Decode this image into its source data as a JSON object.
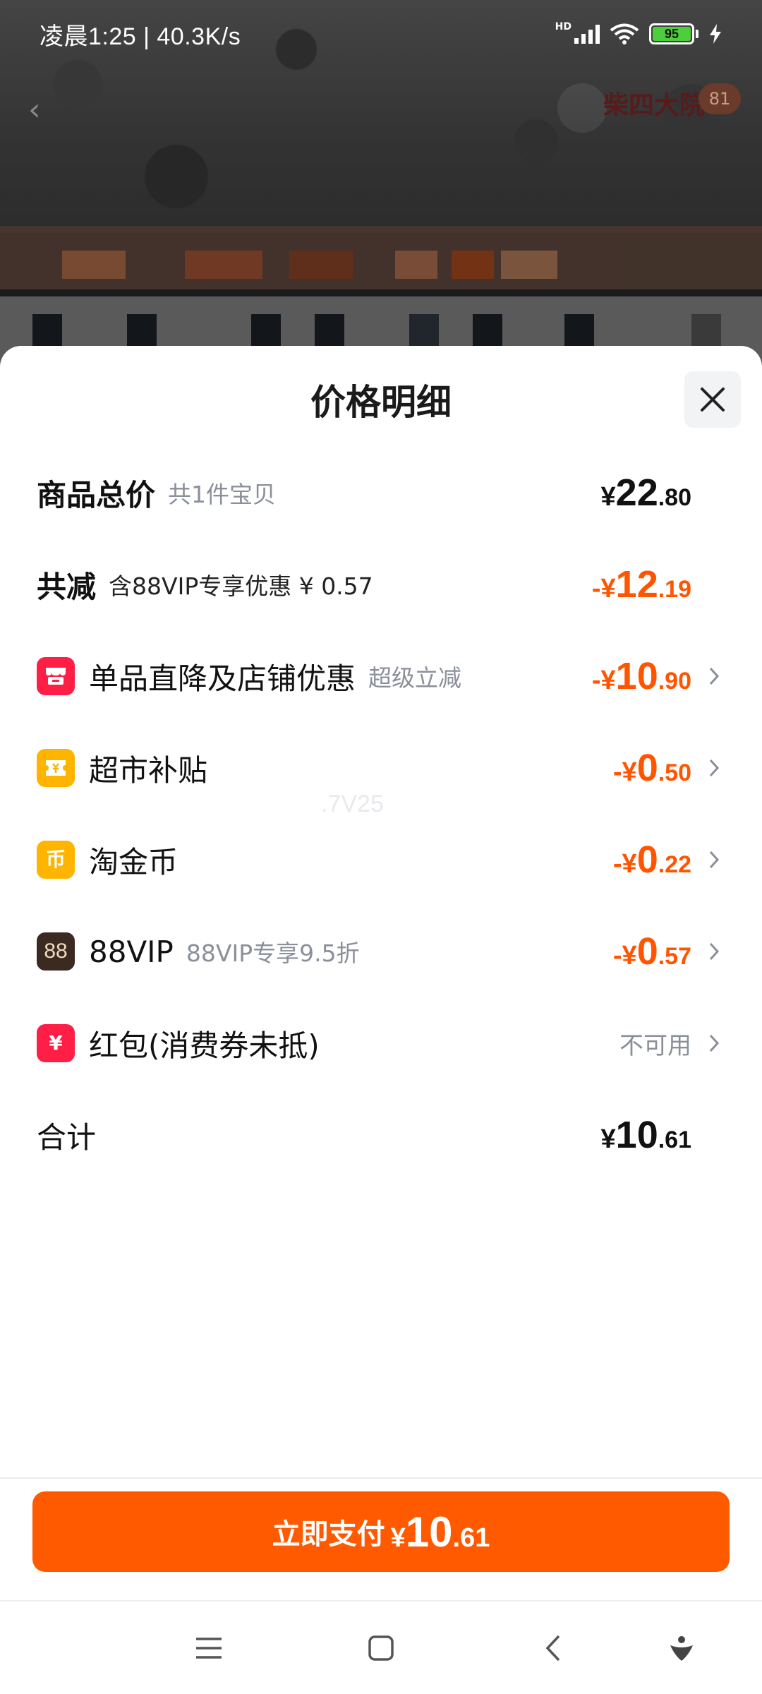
{
  "status_bar": {
    "time": "凌晨1:25 | 40.3K/s",
    "network_label": "HD",
    "battery": "95"
  },
  "background": {
    "badge_count": "81",
    "store_logo": "柴四大院"
  },
  "sheet": {
    "title": "价格明细",
    "close_icon": "close-icon",
    "watermark": ".7V25",
    "rows": [
      {
        "label": "商品总价",
        "sub": "共1件宝贝",
        "currency": "¥",
        "int": "22",
        "dec": ".80"
      },
      {
        "label": "共减",
        "sub": "含88VIP专享优惠 ¥ 0.57",
        "currency": "-¥",
        "int": "12",
        "dec": ".19"
      },
      {
        "label": "单品直降及店铺优惠",
        "sub": "超级立减",
        "icon": "store-icon",
        "currency": "-¥",
        "int": "10",
        "dec": ".90"
      },
      {
        "label": "超市补贴",
        "icon": "coupon-icon",
        "currency": "-¥",
        "int": "0",
        "dec": ".50"
      },
      {
        "label": "淘金币",
        "icon": "coin-icon",
        "icon_text": "币",
        "currency": "-¥",
        "int": "0",
        "dec": ".22"
      },
      {
        "label": "88VIP",
        "sub": "88VIP专享9.5折",
        "icon": "vip-icon",
        "icon_text": "88",
        "currency": "-¥",
        "int": "0",
        "dec": ".57"
      },
      {
        "label": "红包(消费券未抵)",
        "icon": "red-packet-icon",
        "icon_text": "¥",
        "status": "不可用"
      },
      {
        "label": "合计",
        "currency": "¥",
        "int": "10",
        "dec": ".61"
      }
    ]
  },
  "pay_button": {
    "label": "立即支付",
    "currency": "¥",
    "int": "10",
    "dec": ".61"
  },
  "nav": [
    "menu-icon",
    "home-icon",
    "back-icon",
    "assistant-icon"
  ],
  "colors": {
    "accent": "#ff5500",
    "pay_button": "#ff5a00",
    "muted": "#8a8f99",
    "icon_red": "#ff1e46",
    "icon_yellow": "#ffb400"
  }
}
